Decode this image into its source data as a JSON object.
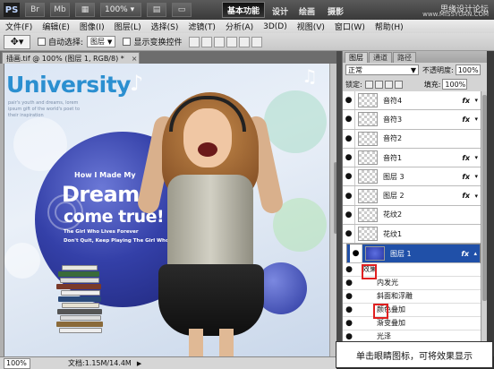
{
  "titlebar": {
    "logo": "PS",
    "btn1": "Br",
    "btn2": "Mb",
    "zoom_value": "100%",
    "workspace": "基本功能",
    "ws_design": "设计",
    "ws_paint": "绘画",
    "ws_photo": "摄影",
    "watermark": "思缘设计论坛",
    "watermark_url": "www.MISSYUAN.COM"
  },
  "menu": [
    "文件(F)",
    "编辑(E)",
    "图像(I)",
    "图层(L)",
    "选择(S)",
    "滤镜(T)",
    "分析(A)",
    "3D(D)",
    "视图(V)",
    "窗口(W)",
    "帮助(H)"
  ],
  "options": {
    "auto_select_label": "自动选择:",
    "auto_select_value": "图层",
    "show_transform_label": "显示变换控件"
  },
  "doc_tab": {
    "title": "插画.tif @ 100% (图层 1, RGB/8) *",
    "close": "×"
  },
  "canvas": {
    "title": "University",
    "subtitle": "pair's youth and dreams, lorem ipsum gift of the world's poet to their inspiration",
    "howi": "How I Made My",
    "dreams": "Dreams",
    "cometrue": "come true!",
    "gwlf": "The Girl Who Lives Forever",
    "dq": "Don't Quit, Keep Playing The Girl Who Lives Forever"
  },
  "caption": "单击眼睛图标，可将效果显示",
  "status": {
    "zoom": "100%",
    "doc": "文档:1.15M/14.4M"
  },
  "panel": {
    "tabs": [
      "图层",
      "通道",
      "路径"
    ],
    "blend_mode": "正常",
    "opacity_label": "不透明度:",
    "opacity_value": "100%",
    "lock_label": "锁定:",
    "fill_label": "填充:",
    "fill_value": "100%",
    "layers": [
      {
        "name": "音符4",
        "fx": true
      },
      {
        "name": "音符3",
        "fx": true
      },
      {
        "name": "音符2",
        "fx": false
      },
      {
        "name": "音符1",
        "fx": true
      },
      {
        "name": "图层 3",
        "fx": true
      },
      {
        "name": "图层 2",
        "fx": true
      },
      {
        "name": "花纹2",
        "fx": false
      },
      {
        "name": "花纹1",
        "fx": false
      },
      {
        "name": "图层 1",
        "fx": true
      }
    ],
    "effects_header": "效果",
    "effects": [
      "内发光",
      "斜面和浮雕",
      "颜色叠加",
      "渐变叠加",
      "光泽"
    ],
    "fx_symbol": "fx"
  },
  "colors": {
    "selected_layer": "#2050a8",
    "highlight_box": "#e02020",
    "title_blue": "#2b8fd0"
  }
}
